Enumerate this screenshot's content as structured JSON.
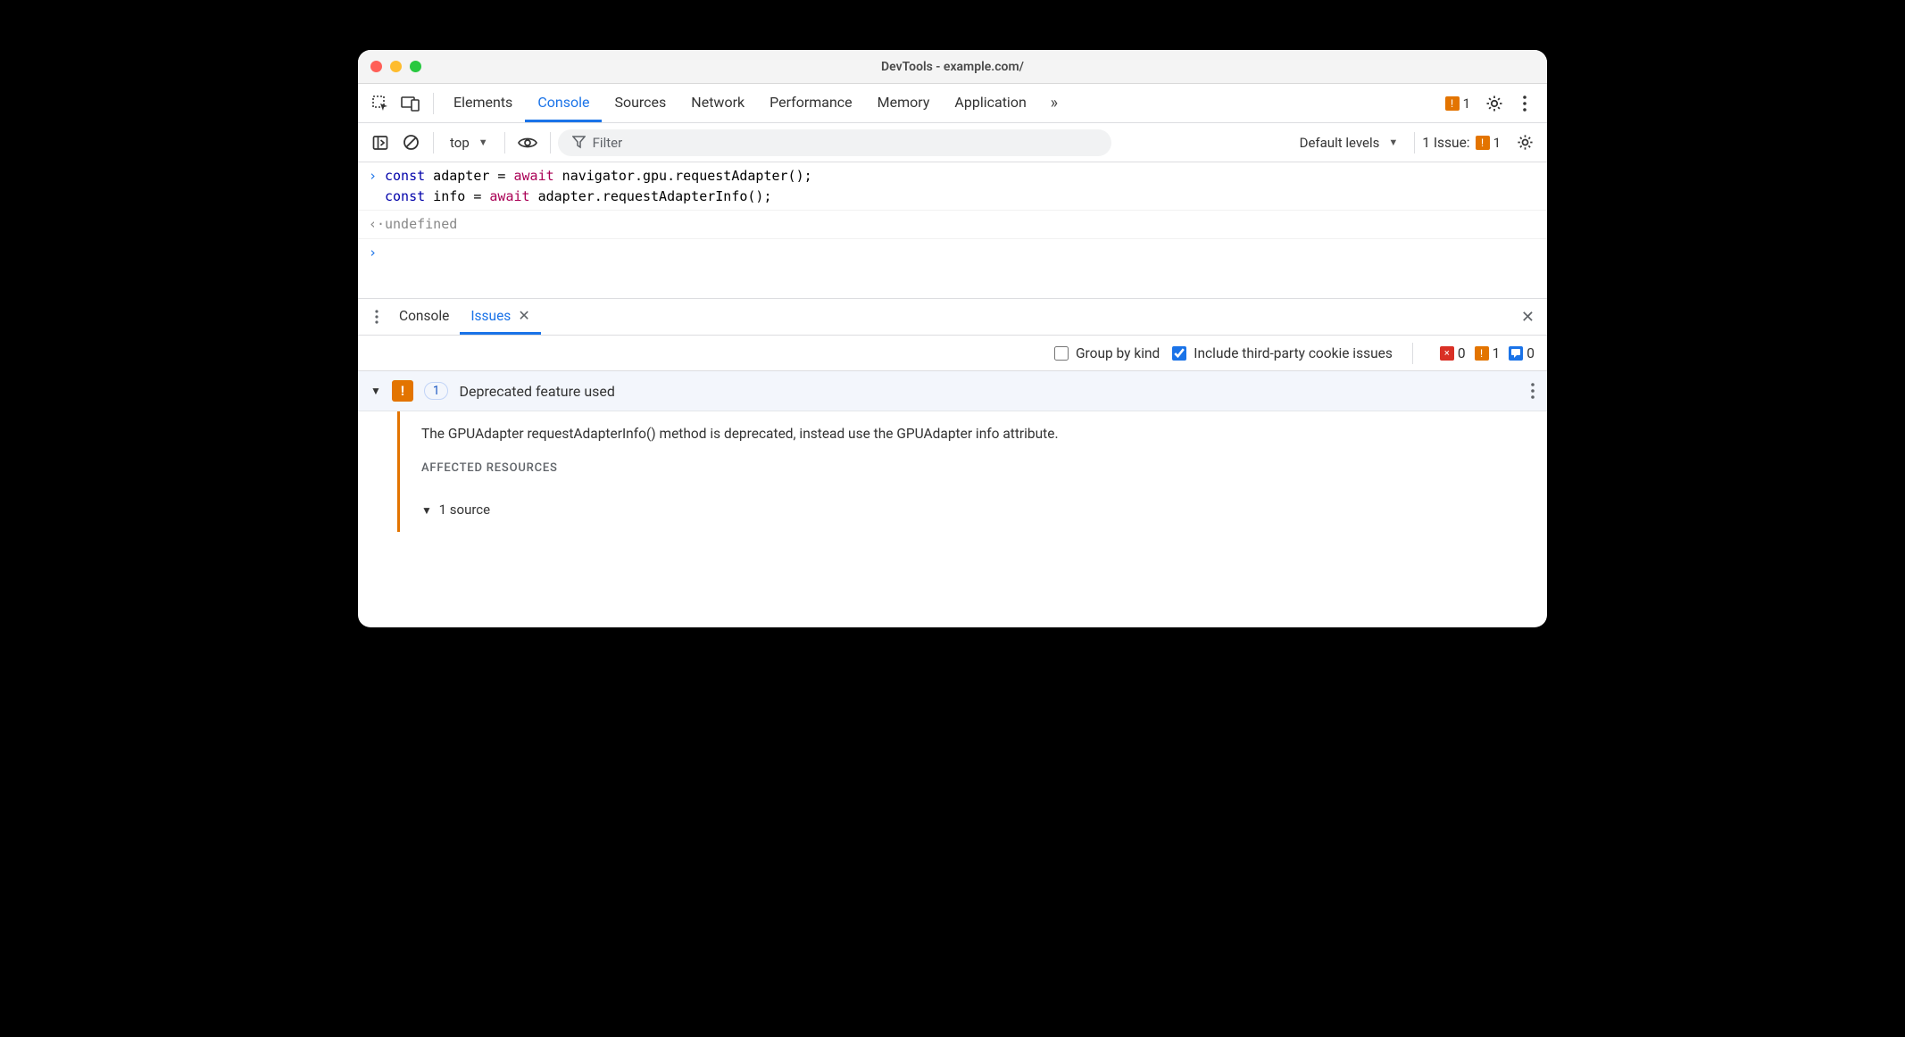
{
  "window": {
    "title": "DevTools - example.com/"
  },
  "toolbar": {
    "tabs": [
      "Elements",
      "Console",
      "Sources",
      "Network",
      "Performance",
      "Memory",
      "Application"
    ],
    "active_tab": "Console",
    "warn_count": "1"
  },
  "console_bar": {
    "context_label": "top",
    "filter_placeholder": "Filter",
    "levels_label": "Default levels",
    "issue_label": "1 Issue:",
    "issue_count": "1"
  },
  "console": {
    "input_line1_const": "const",
    "input_line1_rest1": " adapter = ",
    "input_line1_await": "await",
    "input_line1_rest2": " navigator.gpu.requestAdapter();",
    "input_line2_const": "const",
    "input_line2_rest1": " info = ",
    "input_line2_await": "await",
    "input_line2_rest2": " adapter.requestAdapterInfo();",
    "output": "undefined"
  },
  "drawer": {
    "tabs": {
      "console": "Console",
      "issues": "Issues"
    },
    "active": "Issues"
  },
  "issues_toolbar": {
    "group_label": "Group by kind",
    "thirdparty_label": "Include third-party cookie issues",
    "err_count": "0",
    "warn_count": "1",
    "info_count": "0"
  },
  "issue": {
    "count": "1",
    "title": "Deprecated feature used",
    "description": "The GPUAdapter requestAdapterInfo() method is deprecated, instead use the GPUAdapter info attribute.",
    "affected_label": "AFFECTED RESOURCES",
    "source_label": "1 source"
  }
}
